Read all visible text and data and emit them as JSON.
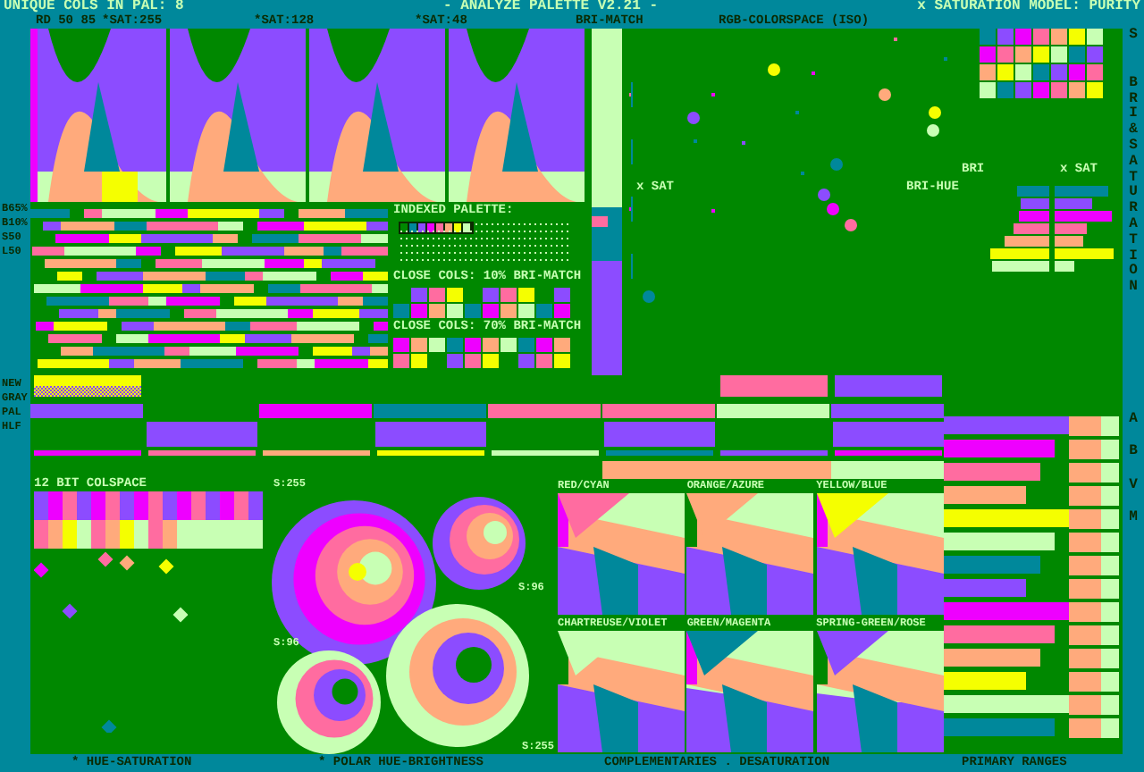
{
  "header": {
    "unique_count": "UNIQUE COLS IN PAL: 8",
    "title": "- ANALYZE PALETTE V2.21 -",
    "saturation_model": "x SATURATION MODEL: PURITY"
  },
  "column_heads": [
    "RD 50 85",
    "*SAT:255",
    "*SAT:128",
    "*SAT:48",
    "BRI-MATCH",
    "RGB-COLORSPACE (ISO)"
  ],
  "row_labels_top": [
    "B65%",
    "B10%",
    "S50",
    "L50"
  ],
  "row_labels_mid": [
    "NEW",
    "GRAY",
    "PAL",
    "HLF"
  ],
  "indexed_palette": {
    "title": "INDEXED PALETTE:",
    "colors": [
      {
        "color": "#008800"
      },
      {
        "color": "#00889b"
      },
      {
        "color": "#8c4cff"
      },
      {
        "color": "#ee00ff"
      },
      {
        "color": "#ff6ca0"
      },
      {
        "color": "#ffaa7c"
      },
      {
        "color": "#f5ff00"
      },
      {
        "color": "#c8ffb4"
      }
    ]
  },
  "close_cols": [
    "CLOSE COLS: 10% BRI-MATCH",
    "CLOSE COLS: 70% BRI-MATCH"
  ],
  "bri_sat": {
    "x_sat_left": "x SAT",
    "bri_hue": "BRI-HUE",
    "bri": "BRI",
    "x_sat_right": "x SAT"
  },
  "side_fragment": "S",
  "side_title": "BRI & SATURATION",
  "side_bottom": "ABVM",
  "colspace_title": "12 BIT COLSPACE",
  "polar_labels": [
    "S:255",
    "S:96",
    "S:96",
    "S:255"
  ],
  "complementaries": [
    "RED/CYAN",
    "ORANGE/AZURE",
    "YELLOW/BLUE",
    "CHARTREUSE/VIOLET",
    "GREEN/MAGENTA",
    "SPRING-GREEN/ROSE"
  ],
  "captions": [
    "* HUE-SATURATION",
    "* POLAR HUE-BRIGHTNESS",
    "COMPLEMENTARIES . DESATURATION",
    "PRIMARY RANGES"
  ]
}
